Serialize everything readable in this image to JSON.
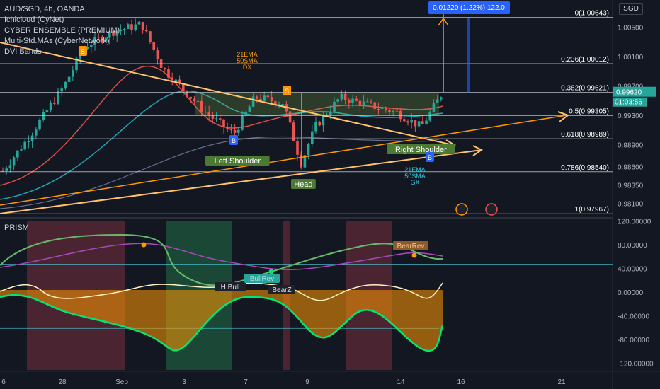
{
  "header": {
    "symbol": "AUD/SGD, 4h, OANDA",
    "indicators": [
      "Ichicloud (CyNet)",
      "CYBER ENSEMBLE (PREMIUM)",
      "Multi-Std.MAs (CyberNetwork)",
      "DVI Bands"
    ],
    "currency": "SGD",
    "oscillator_title": "PRISM"
  },
  "colors": {
    "background": "#131722",
    "up_candle": "#26a69a",
    "down_candle": "#ef5350",
    "trendline": "#ffc46b",
    "orange": "#ff9800",
    "blue": "#2962ff",
    "fib": "#d1d4dc"
  },
  "measure_label": "0.01220 (1.22%) 122.0",
  "price_tag": "0.99620",
  "countdown": "01:03:56",
  "chart_data": [
    {
      "type": "candlestick",
      "title": "AUD/SGD, 4h, OANDA",
      "x_ticks": [
        "6",
        "28",
        "Sep",
        "3",
        "7",
        "9",
        "14",
        "16",
        "21"
      ],
      "y_ticks": [
        1.005,
        1.001,
        0.997,
        0.993,
        0.989,
        0.986,
        0.9835,
        0.981
      ],
      "y_tick_labels": [
        "1.00500",
        "1.00100",
        "0.99700",
        "0.99300",
        "0.98900",
        "0.98600",
        "0.98350",
        "0.98100"
      ],
      "ylim": [
        0.9794,
        1.0088
      ],
      "fib_levels": [
        {
          "label": "0(1.00643)",
          "price": 1.00643
        },
        {
          "label": "0.236(1.00012)",
          "price": 1.00012
        },
        {
          "label": "0.382(0.99621)",
          "price": 0.99621
        },
        {
          "label": "0.5(0.99305)",
          "price": 0.99305
        },
        {
          "label": "0.618(0.98989)",
          "price": 0.98989
        },
        {
          "label": "0.786(0.98540)",
          "price": 0.9854
        },
        {
          "label": "1(0.97967)",
          "price": 0.97967
        }
      ],
      "pattern_labels": [
        "Left Shoulder",
        "Head",
        "Right Shoulder"
      ],
      "annotations": [
        "21EMA 50SMA DX",
        "21EMA 50SMA GX"
      ],
      "signal_labels": [
        "S",
        "B",
        "S",
        "B"
      ],
      "last_price": 0.9962
    },
    {
      "type": "line",
      "title": "PRISM",
      "y_ticks": [
        120,
        80,
        40,
        0,
        -40,
        -80,
        -120
      ],
      "y_tick_labels": [
        "120.00000",
        "80.00000",
        "40.00000",
        "0.00000",
        "-40.00000",
        "-80.00000",
        "-120.00000"
      ],
      "ylim": [
        -130,
        122
      ],
      "labels": [
        "H Bull",
        "BullRev",
        "BearZ",
        "BearRev"
      ]
    }
  ]
}
